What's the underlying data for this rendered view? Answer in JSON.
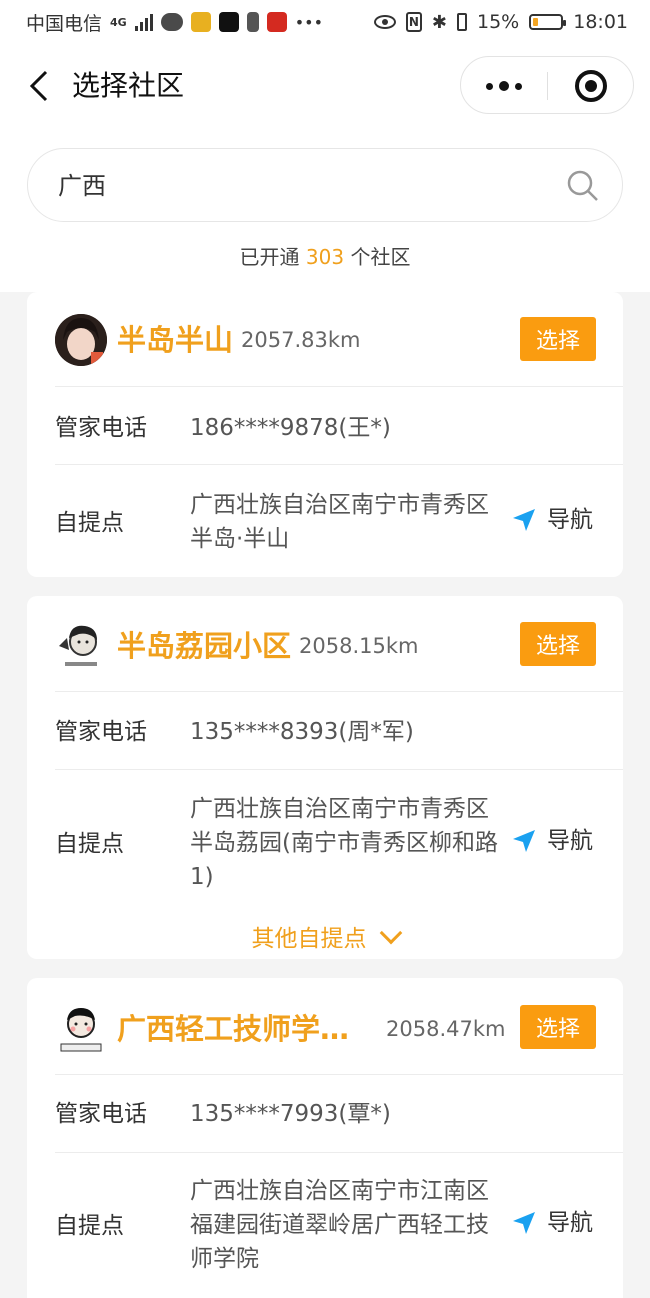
{
  "status_bar": {
    "carrier": "中国电信",
    "network": "4G",
    "battery": "15%",
    "battery_level": 0.15,
    "time": "18:01",
    "battery_color": "#f5a623"
  },
  "header": {
    "title": "选择社区",
    "back_icon": "chevron-left-icon",
    "more_icon": "more-dots-icon",
    "close_icon": "target-close-icon"
  },
  "search": {
    "value": "广西",
    "icon": "search-icon"
  },
  "summary": {
    "prefix": "已开通",
    "count": "303",
    "suffix": "个社区"
  },
  "accent_color": "#f0a01d",
  "button_color": "#fa9c10",
  "communities": [
    {
      "name": "半岛半山",
      "distance": "2057.83km",
      "select_label": "选择",
      "phone_label": "管家电话",
      "phone": "186****9878(王*)",
      "pickup_label": "自提点",
      "pickup_address": "广西壮族自治区南宁市青秀区半岛·半山",
      "nav_label": "导航"
    },
    {
      "name": "半岛荔园小区",
      "distance": "2058.15km",
      "select_label": "选择",
      "phone_label": "管家电话",
      "phone": "135****8393(周*军)",
      "pickup_label": "自提点",
      "pickup_address": "广西壮族自治区南宁市青秀区半岛荔园(南宁市青秀区柳和路1)",
      "nav_label": "导航",
      "more_label": "其他自提点"
    },
    {
      "name": "广西轻工技师学…",
      "distance": "2058.47km",
      "select_label": "选择",
      "phone_label": "管家电话",
      "phone": "135****7993(覃*)",
      "pickup_label": "自提点",
      "pickup_address": "广西壮族自治区南宁市江南区福建园街道翠岭居广西轻工技师学院",
      "nav_label": "导航"
    }
  ]
}
